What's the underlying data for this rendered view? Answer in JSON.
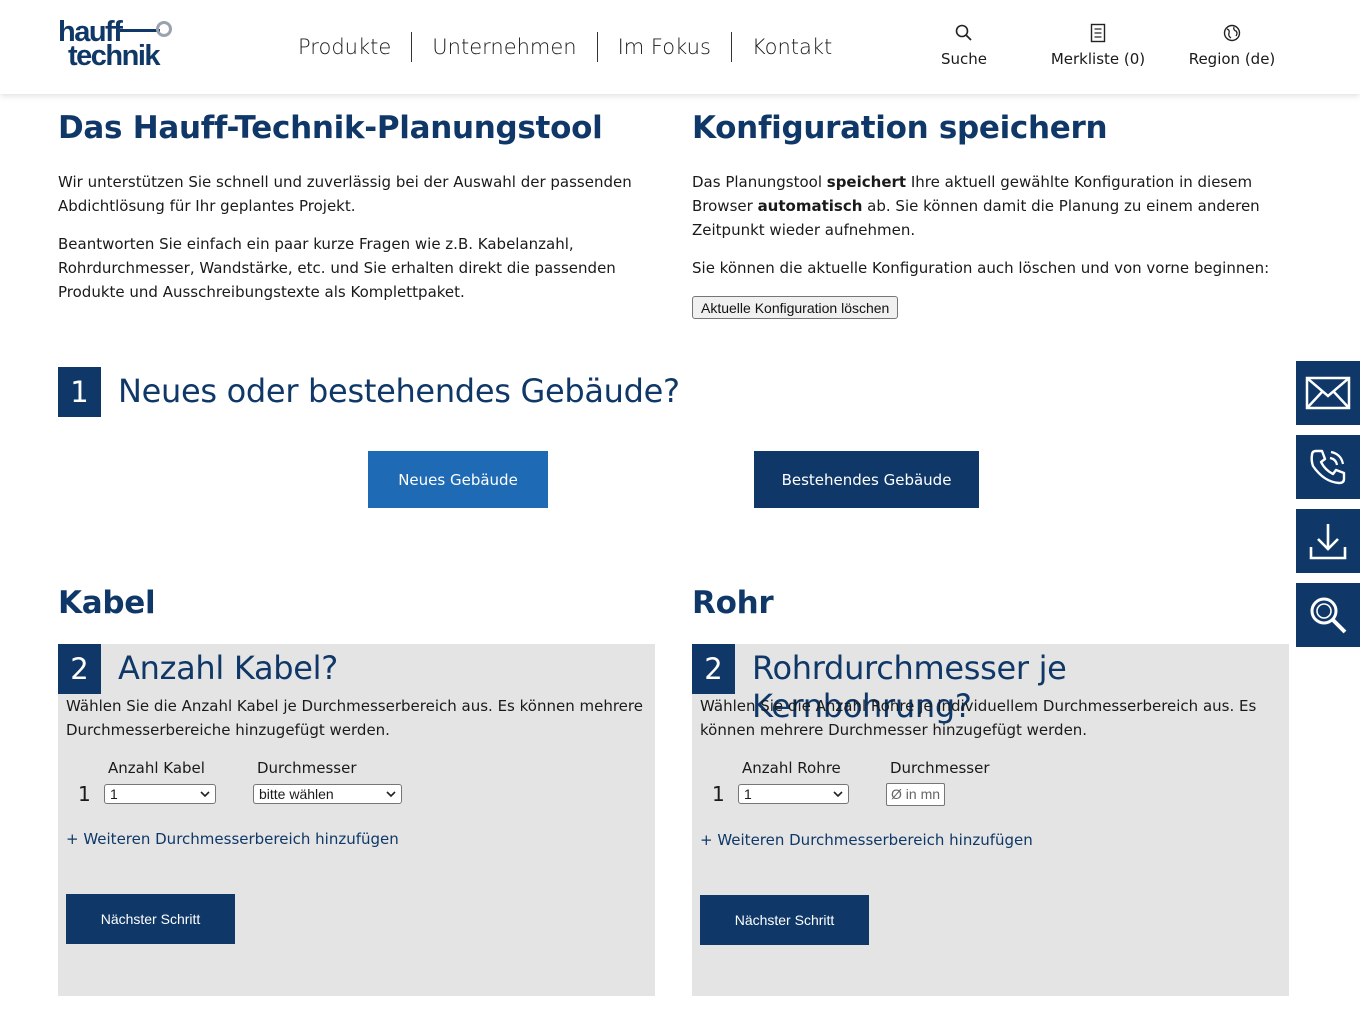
{
  "brand": {
    "line1": "hauff",
    "line2": "technik"
  },
  "nav": {
    "items": [
      "Produkte",
      "Unternehmen",
      "Im Fokus",
      "Kontakt"
    ]
  },
  "tools": {
    "search": "Suche",
    "watchlist": "Merkliste (0)",
    "region": "Region (de)"
  },
  "intro": {
    "title": "Das Hauff-Technik-Planungstool",
    "p1": "Wir unterstützen Sie schnell und zuverlässig bei der Auswahl der passenden Abdichtlösung für Ihr geplantes Projekt.",
    "p2": "Beantworten Sie einfach ein paar kurze Fragen wie z.B. Kabelanzahl, Rohrdurchmesser, Wandstärke, etc. und Sie erhalten direkt die passenden Produkte und Ausschreibungstexte als Komplettpaket."
  },
  "config": {
    "title": "Konfiguration speichern",
    "p1_a": "Das Planungstool ",
    "p1_b": "speichert",
    "p1_c": " Ihre aktuell gewählte Konfiguration in diesem Browser ",
    "p1_d": "automatisch",
    "p1_e": " ab. Sie können damit die Planung zu einem anderen Zeitpunkt wieder aufnehmen.",
    "p2": "Sie können die aktuelle Konfiguration auch löschen und von vorne beginnen:",
    "clear_button": "Aktuelle Konfiguration löschen"
  },
  "step1": {
    "number": "1",
    "title": "Neues oder bestehendes Gebäude?",
    "option_new": "Neues Gebäude",
    "option_existing": "Bestehendes Gebäude"
  },
  "kabel": {
    "heading": "Kabel",
    "number": "2",
    "title": "Anzahl Kabel?",
    "desc": "Wählen Sie die Anzahl Kabel je Durchmesserbereich aus. Es können mehrere Durchmesserbereiche hinzugefügt werden.",
    "col_count": "Anzahl Kabel",
    "col_diameter": "Durchmesser",
    "row_index": "1",
    "count_value": "1",
    "diameter_value": "bitte wählen",
    "add_link": "+ Weiteren Durchmesserbereich hinzufügen",
    "next_button": "Nächster Schritt"
  },
  "rohr": {
    "heading": "Rohr",
    "number": "2",
    "title": "Rohrdurchmesser je Kernbohrung?",
    "desc": "Wählen Sie die Anzahl Rohre je individuellem Durchmesserbereich aus. Es können mehrere Durchmesser hinzugefügt werden.",
    "col_count": "Anzahl Rohre",
    "col_diameter": "Durchmesser",
    "row_index": "1",
    "count_value": "1",
    "diameter_placeholder": "Ø in mn",
    "add_link": "+ Weiteren Durchmesserbereich hinzufügen",
    "next_button": "Nächster Schritt"
  },
  "colors": {
    "primary": "#0f3868",
    "accent": "#1e6ab4",
    "panel": "#e4e4e4"
  }
}
